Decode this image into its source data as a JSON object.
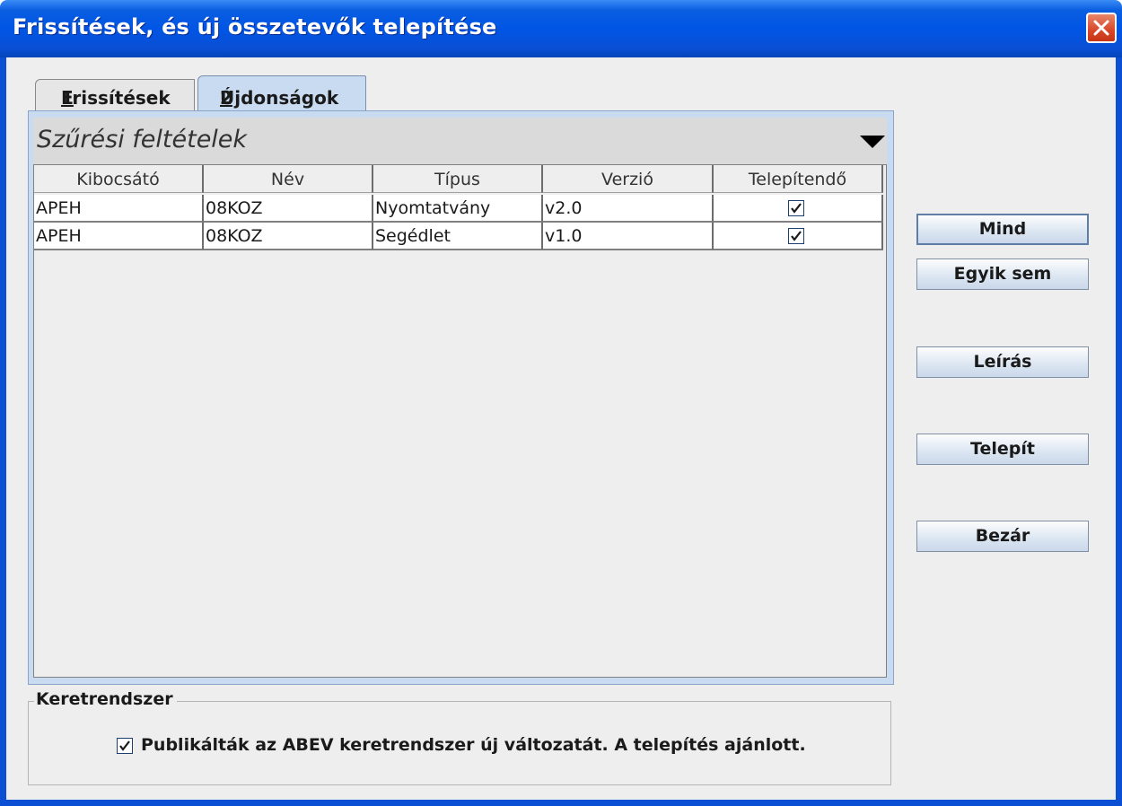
{
  "window": {
    "title": "Frissítések, és új összetevők telepítése",
    "close_icon": "close-icon"
  },
  "tabs": [
    {
      "label": "Frissítések ",
      "mnemonic": "1",
      "selected": false
    },
    {
      "label": "Újdonságok ",
      "mnemonic": "2",
      "selected": true
    }
  ],
  "filter": {
    "label": "Szűrési feltételek",
    "icon": "triangle-down-icon"
  },
  "table": {
    "columns": [
      "Kibocsátó",
      "Név",
      "Típus",
      "Verzió",
      "Telepítendő"
    ],
    "rows": [
      {
        "kibocsato": "APEH",
        "nev": "08KOZ",
        "tipus": "Nyomtatvány",
        "verzio": "v2.0",
        "telepitendo": true
      },
      {
        "kibocsato": "APEH",
        "nev": "08KOZ",
        "tipus": "Segédlet",
        "verzio": "v1.0",
        "telepitendo": true
      }
    ]
  },
  "buttons": {
    "mind": "Mind",
    "egyik_sem": "Egyik sem",
    "leiras": "Leírás",
    "telepit": "Telepít",
    "bezar": "Bezár"
  },
  "framework": {
    "group_title": "Keretrendszer",
    "notice": "Publikálták az ABEV keretrendszer új változatát. A telepítés ajánlott.",
    "notice_checked": true
  },
  "colors": {
    "titlebar": "#0055e5",
    "selected_tab": "#c9dbf0",
    "close_button": "#d8472a"
  }
}
